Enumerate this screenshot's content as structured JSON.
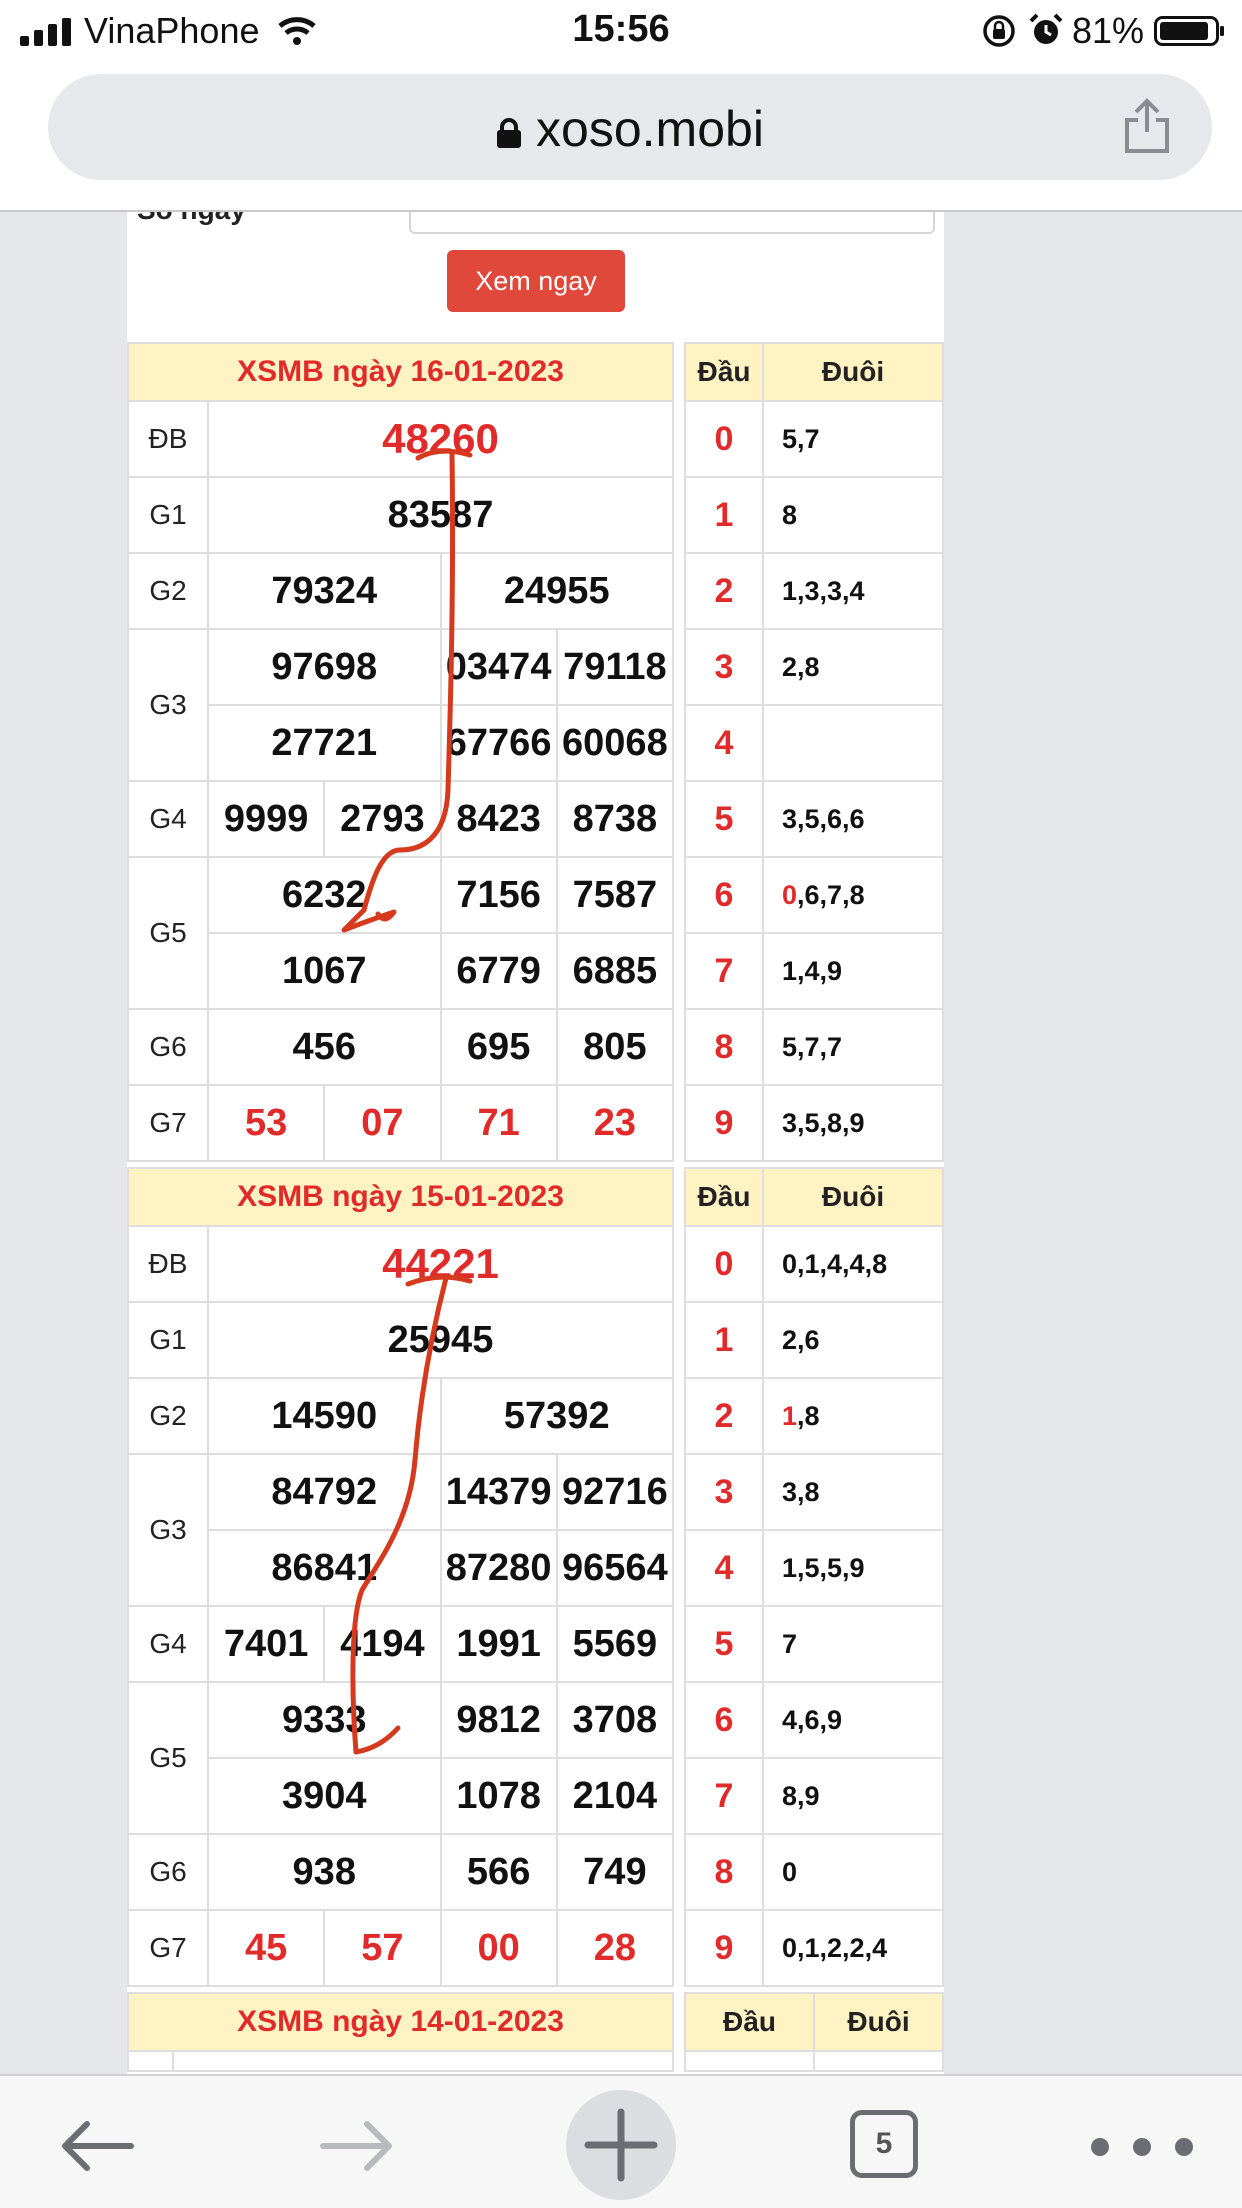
{
  "status_bar": {
    "carrier": "VinaPhone",
    "time": "15:56",
    "battery": "81%"
  },
  "browser": {
    "url": "xoso.mobi",
    "tab_count": "5"
  },
  "search": {
    "label_partial": "Số ngày",
    "button": "Xem ngay"
  },
  "loto_headers": {
    "dau": "Đầu",
    "duoi": "Đuôi"
  },
  "days": [
    {
      "title": "XSMB ngày 16-01-2023",
      "db": "48260",
      "g1": "83587",
      "g2": [
        "79324",
        "24955"
      ],
      "g3": [
        "97698",
        "03474",
        "79118",
        "27721",
        "67766",
        "60068"
      ],
      "g4": [
        "9999",
        "2793",
        "8423",
        "8738"
      ],
      "g5": [
        "6232",
        "7156",
        "7587",
        "1067",
        "6779",
        "6885"
      ],
      "g6": [
        "456",
        "695",
        "805"
      ],
      "g7": [
        "53",
        "07",
        "71",
        "23"
      ],
      "loto": [
        {
          "dau": "0",
          "hl": "",
          "rest": "5,7"
        },
        {
          "dau": "1",
          "hl": "",
          "rest": "8"
        },
        {
          "dau": "2",
          "hl": "",
          "rest": "1,3,3,4"
        },
        {
          "dau": "3",
          "hl": "",
          "rest": "2,8"
        },
        {
          "dau": "4",
          "hl": "",
          "rest": ""
        },
        {
          "dau": "5",
          "hl": "",
          "rest": "3,5,6,6"
        },
        {
          "dau": "6",
          "hl": "0",
          "rest": ",6,7,8"
        },
        {
          "dau": "7",
          "hl": "",
          "rest": "1,4,9"
        },
        {
          "dau": "8",
          "hl": "",
          "rest": "5,7,7"
        },
        {
          "dau": "9",
          "hl": "",
          "rest": "3,5,8,9"
        }
      ]
    },
    {
      "title": "XSMB ngày 15-01-2023",
      "db": "44221",
      "g1": "25945",
      "g2": [
        "14590",
        "57392"
      ],
      "g3": [
        "84792",
        "14379",
        "92716",
        "86841",
        "87280",
        "96564"
      ],
      "g4": [
        "7401",
        "4194",
        "1991",
        "5569"
      ],
      "g5": [
        "9333",
        "9812",
        "3708",
        "3904",
        "1078",
        "2104"
      ],
      "g6": [
        "938",
        "566",
        "749"
      ],
      "g7": [
        "45",
        "57",
        "00",
        "28"
      ],
      "loto": [
        {
          "dau": "0",
          "hl": "",
          "rest": "0,1,4,4,8"
        },
        {
          "dau": "1",
          "hl": "",
          "rest": "2,6"
        },
        {
          "dau": "2",
          "hl": "1",
          "rest": ",8"
        },
        {
          "dau": "3",
          "hl": "",
          "rest": "3,8"
        },
        {
          "dau": "4",
          "hl": "",
          "rest": "1,5,5,9"
        },
        {
          "dau": "5",
          "hl": "",
          "rest": "7"
        },
        {
          "dau": "6",
          "hl": "",
          "rest": "4,6,9"
        },
        {
          "dau": "7",
          "hl": "",
          "rest": "8,9"
        },
        {
          "dau": "8",
          "hl": "",
          "rest": "0"
        },
        {
          "dau": "9",
          "hl": "",
          "rest": "0,1,2,2,4"
        }
      ]
    },
    {
      "title": "XSMB ngày 14-01-2023"
    }
  ],
  "prize_labels": {
    "db": "ĐB",
    "g1": "G1",
    "g2": "G2",
    "g3": "G3",
    "g4": "G4",
    "g5": "G5",
    "g6": "G6",
    "g7": "G7"
  },
  "colors": {
    "accent_red": "#e12a2a",
    "header_yellow": "#fff3c4",
    "button_red": "#e0483b",
    "annotation_ink": "#d63a1e"
  }
}
